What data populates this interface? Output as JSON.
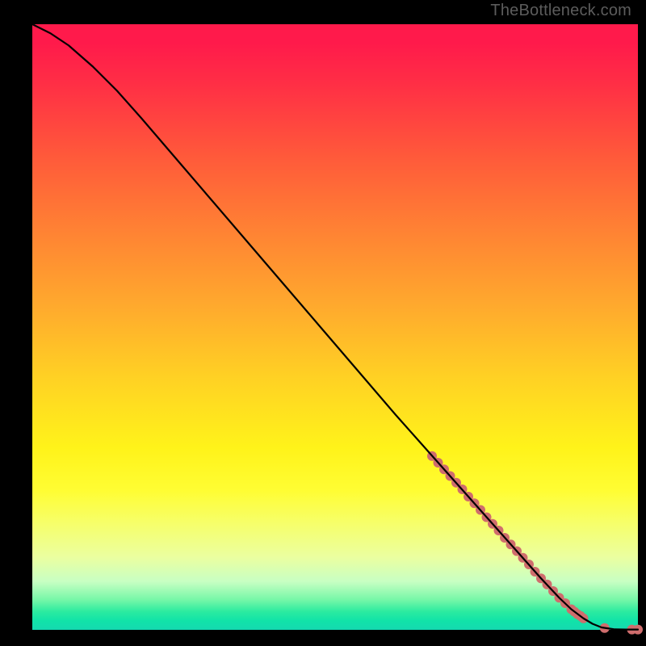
{
  "attribution": "TheBottleneck.com",
  "chart_data": {
    "type": "line",
    "title": "",
    "xlabel": "",
    "ylabel": "",
    "xlim": [
      0,
      100
    ],
    "ylim": [
      0,
      100
    ],
    "series": [
      {
        "name": "curve",
        "style": "line",
        "color": "#000000",
        "x": [
          0,
          3,
          6,
          10,
          14,
          18,
          24,
          30,
          36,
          42,
          48,
          54,
          60,
          64,
          68,
          72,
          76,
          80,
          84,
          87,
          89,
          91,
          92.5,
          94,
          96,
          98,
          100
        ],
        "y": [
          100,
          98.5,
          96.5,
          93,
          89,
          84.5,
          77.5,
          70.5,
          63.5,
          56.5,
          49.5,
          42.5,
          35.5,
          31,
          26.5,
          22,
          17.5,
          13,
          8.5,
          5.3,
          3.4,
          1.9,
          1.0,
          0.4,
          0.1,
          0.05,
          0.05
        ]
      },
      {
        "name": "highlight-markers",
        "style": "markers",
        "color": "#cf6d6d",
        "x": [
          66,
          67,
          68,
          69,
          70,
          71,
          72,
          73,
          74,
          75,
          76,
          77,
          78,
          79,
          80,
          81,
          82,
          83,
          84,
          85,
          86,
          87,
          88,
          89,
          89.5,
          90,
          90.5,
          91,
          94.5,
          99,
          100
        ],
        "y": [
          28.7,
          27.6,
          26.5,
          25.4,
          24.3,
          23.2,
          22.0,
          20.9,
          19.8,
          18.6,
          17.5,
          16.4,
          15.2,
          14.1,
          13.0,
          11.9,
          10.8,
          9.6,
          8.5,
          7.5,
          6.4,
          5.3,
          4.4,
          3.4,
          3.0,
          2.6,
          2.3,
          1.9,
          0.3,
          0.05,
          0.05
        ]
      }
    ]
  }
}
